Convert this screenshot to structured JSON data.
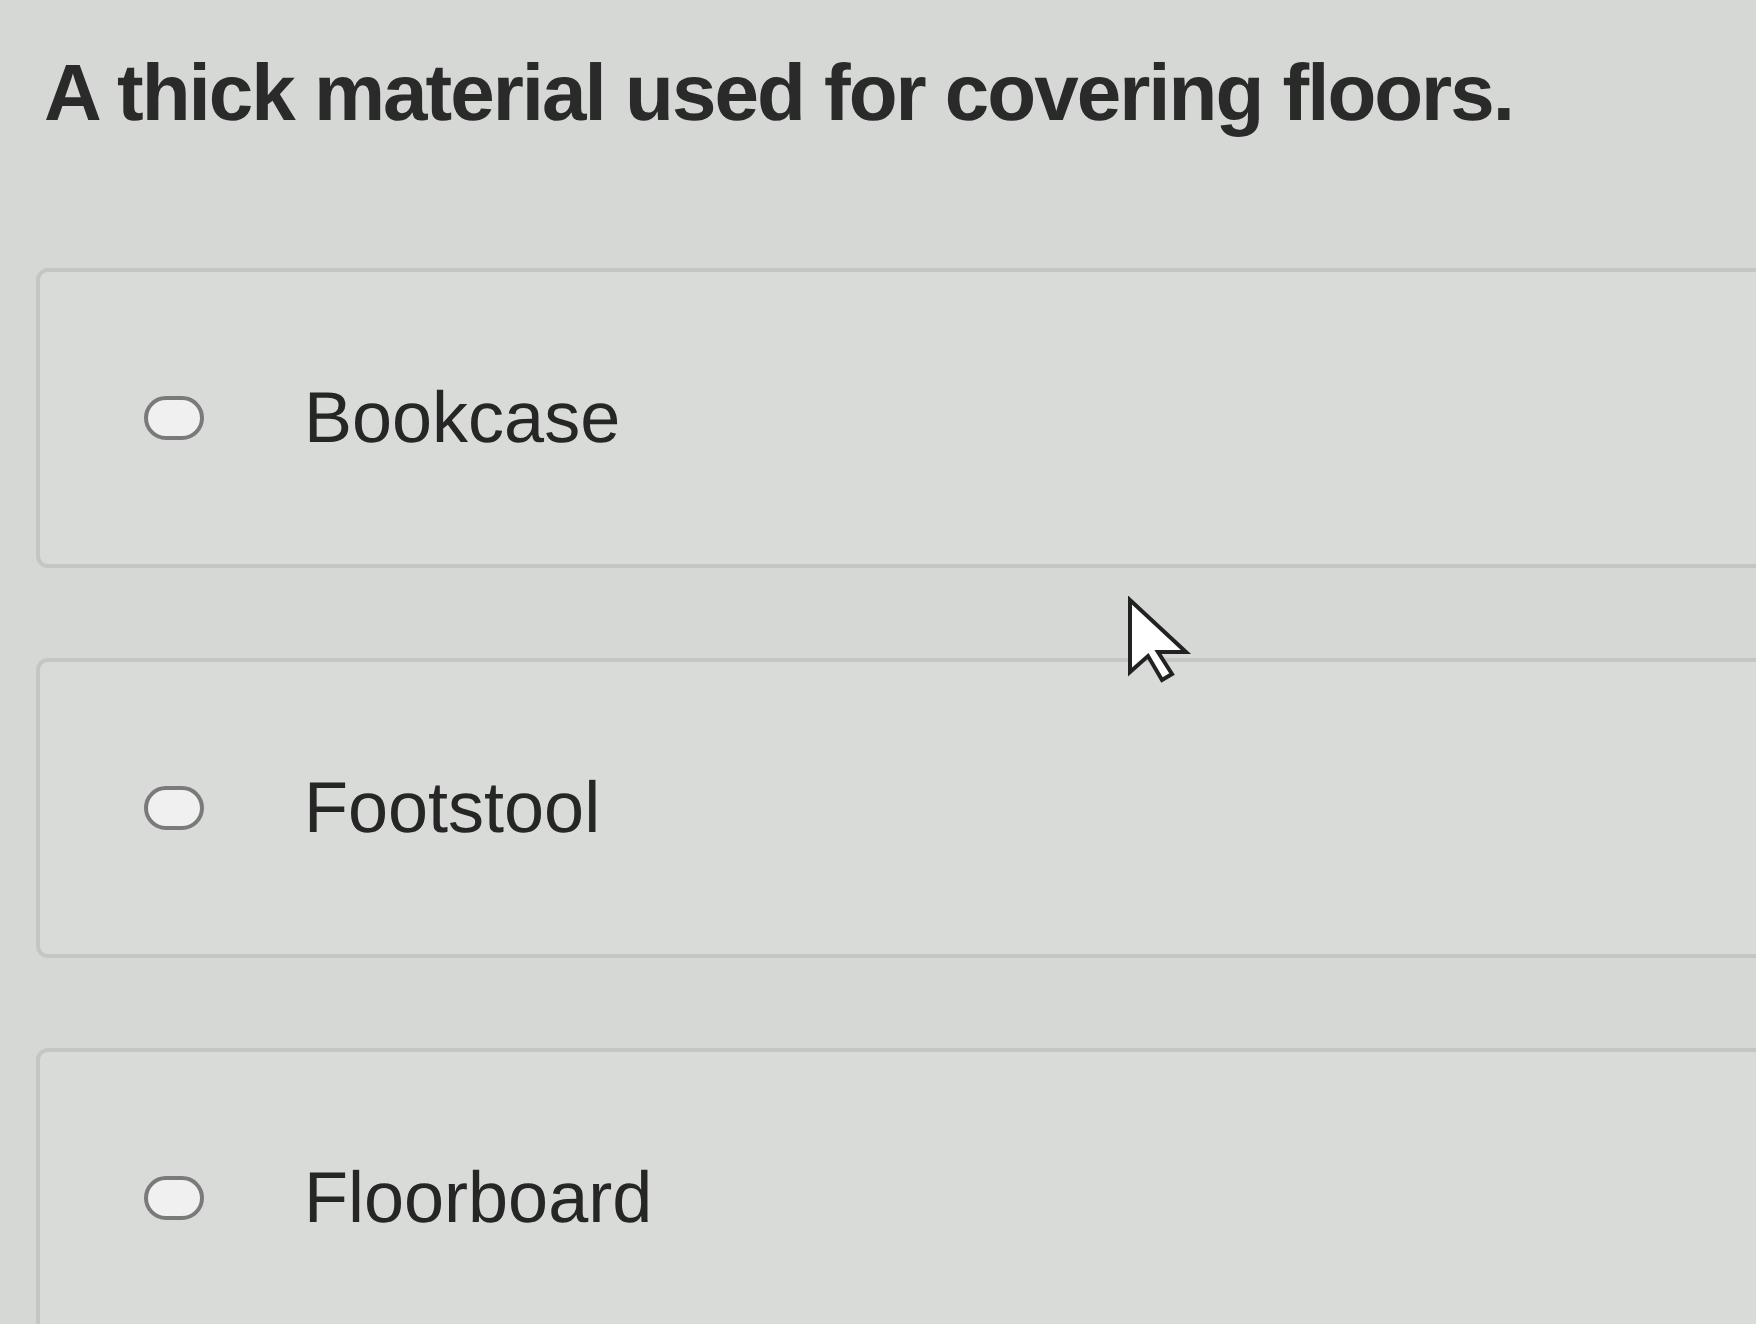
{
  "question": "A thick material used for covering floors.",
  "options": [
    {
      "label": "Bookcase",
      "selected": false
    },
    {
      "label": "Footstool",
      "selected": false
    },
    {
      "label": "Floorboard",
      "selected": false
    }
  ]
}
